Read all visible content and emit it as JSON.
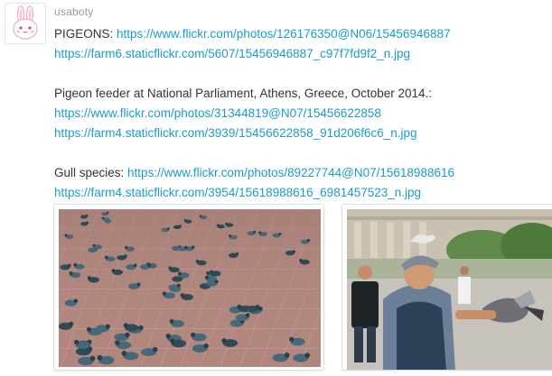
{
  "user": {
    "name": "usaboty"
  },
  "post": {
    "blocks": [
      {
        "label": "PIGEONS: ",
        "link1": "https://www.flickr.com/photos/126176350@N06/15456946887",
        "link2": "https://farm6.staticflickr.com/5607/15456946887_c97f7fd9f2_n.jpg"
      },
      {
        "label": "Pigeon feeder at National Parliament, Athens, Greece, October 2014.:",
        "link1": "https://www.flickr.com/photos/31344819@N07/15456622858",
        "link2": "https://farm4.staticflickr.com/3939/15456622858_91d206f6c6_n.jpg"
      },
      {
        "label": "Gull species: ",
        "link1": "https://www.flickr.com/photos/89227744@N07/15618988616",
        "link2": "https://farm4.staticflickr.com/3954/15618988616_6981457523_n.jpg"
      }
    ]
  },
  "colors": {
    "link": "#1c9bc9",
    "text": "#333333",
    "muted": "#999999"
  }
}
